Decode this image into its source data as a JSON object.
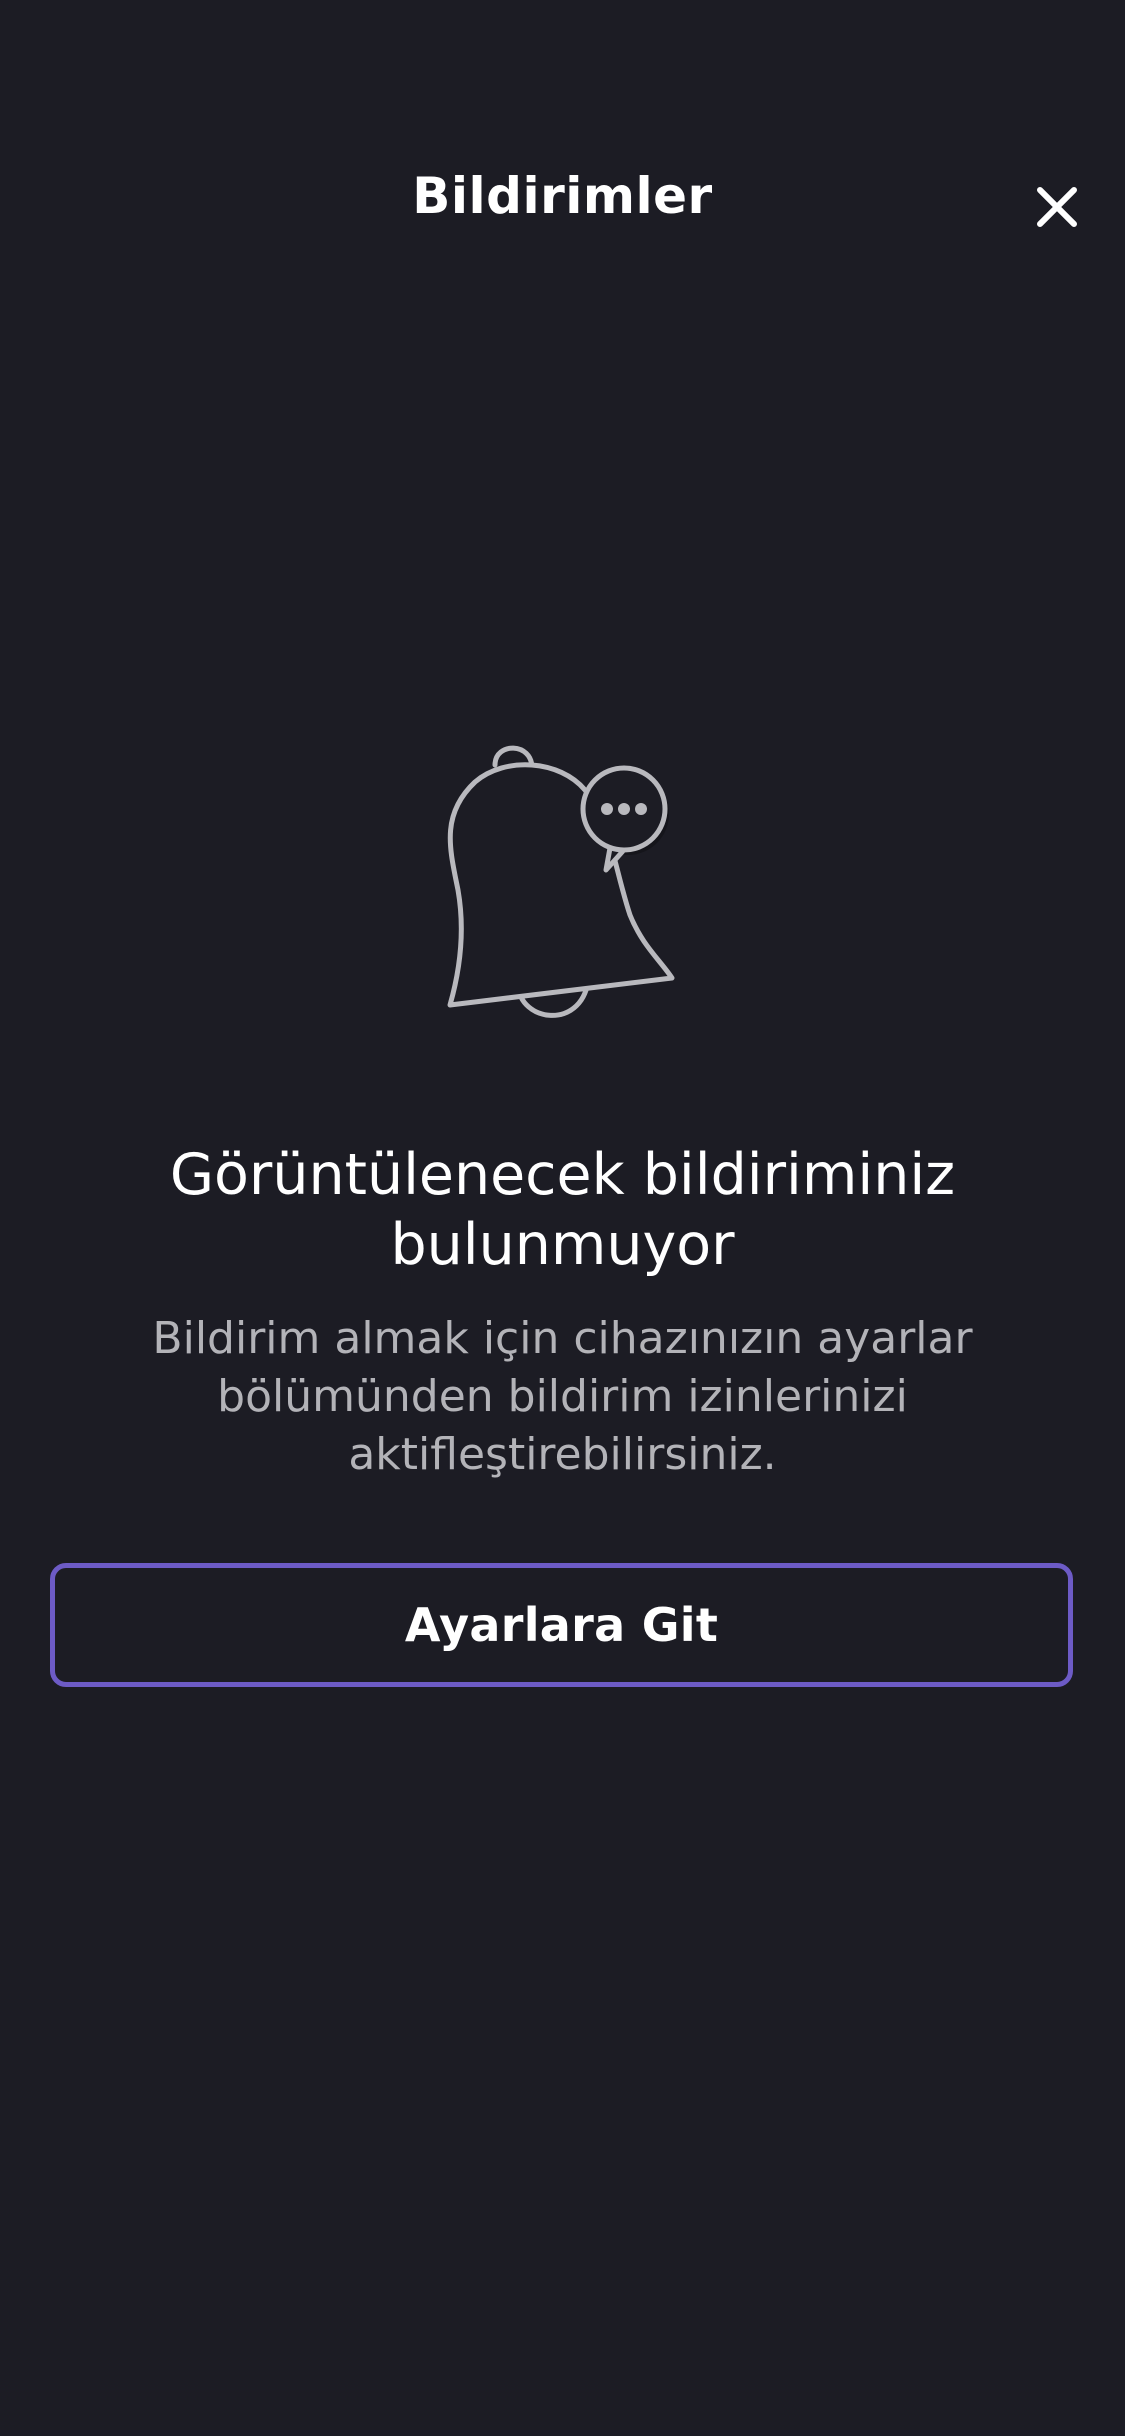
{
  "header": {
    "title": "Bildirimler",
    "close_icon": "close-icon"
  },
  "empty_state": {
    "illustration_icon": "bell-with-chat-bubble-icon",
    "title": "Görüntülenecek bildiriminiz bulunmuyor",
    "description": "Bildirim almak için cihazınızın ayarlar bölümünden bildirim izinlerinizi aktifleştirebilirsiniz."
  },
  "actions": {
    "settings_button_label": "Ayarlara Git"
  },
  "colors": {
    "background": "#1c1c24",
    "button_border": "#6d5bc6",
    "secondary_text": "#b3b3b8"
  }
}
